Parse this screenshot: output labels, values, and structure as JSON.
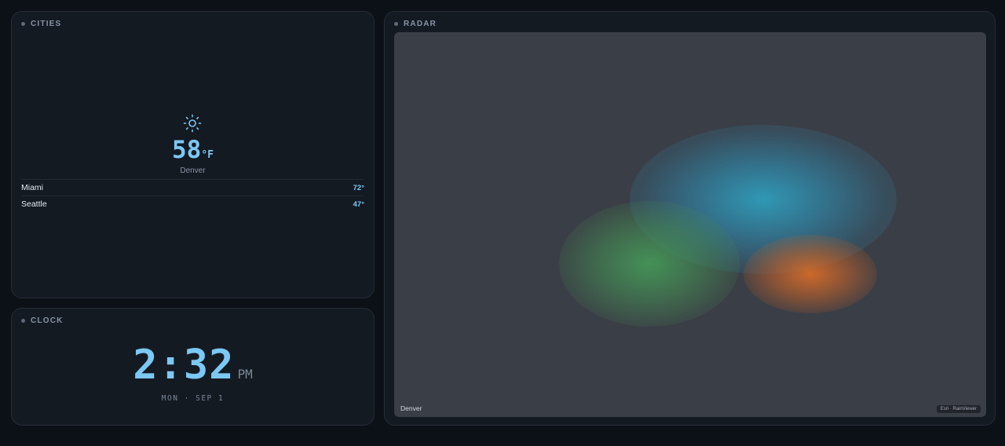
{
  "cities": {
    "header": "CITIES",
    "current": {
      "icon": "sun-icon",
      "temp": "58",
      "unit": "°F",
      "name": "Denver"
    },
    "list": [
      {
        "name": "Miami",
        "temp": "72°"
      },
      {
        "name": "Seattle",
        "temp": "47°"
      }
    ]
  },
  "clock": {
    "header": "CLOCK",
    "time": "2:32",
    "ampm": "PM",
    "date": "MON · SEP 1"
  },
  "radar": {
    "header": "RADAR",
    "location_label": "Denver",
    "attribution": "Esri · RainViewer"
  },
  "colors": {
    "accent": "#7cc8f5",
    "panel": "#141a22",
    "background": "#0c1117",
    "map": "#3a3e46"
  }
}
